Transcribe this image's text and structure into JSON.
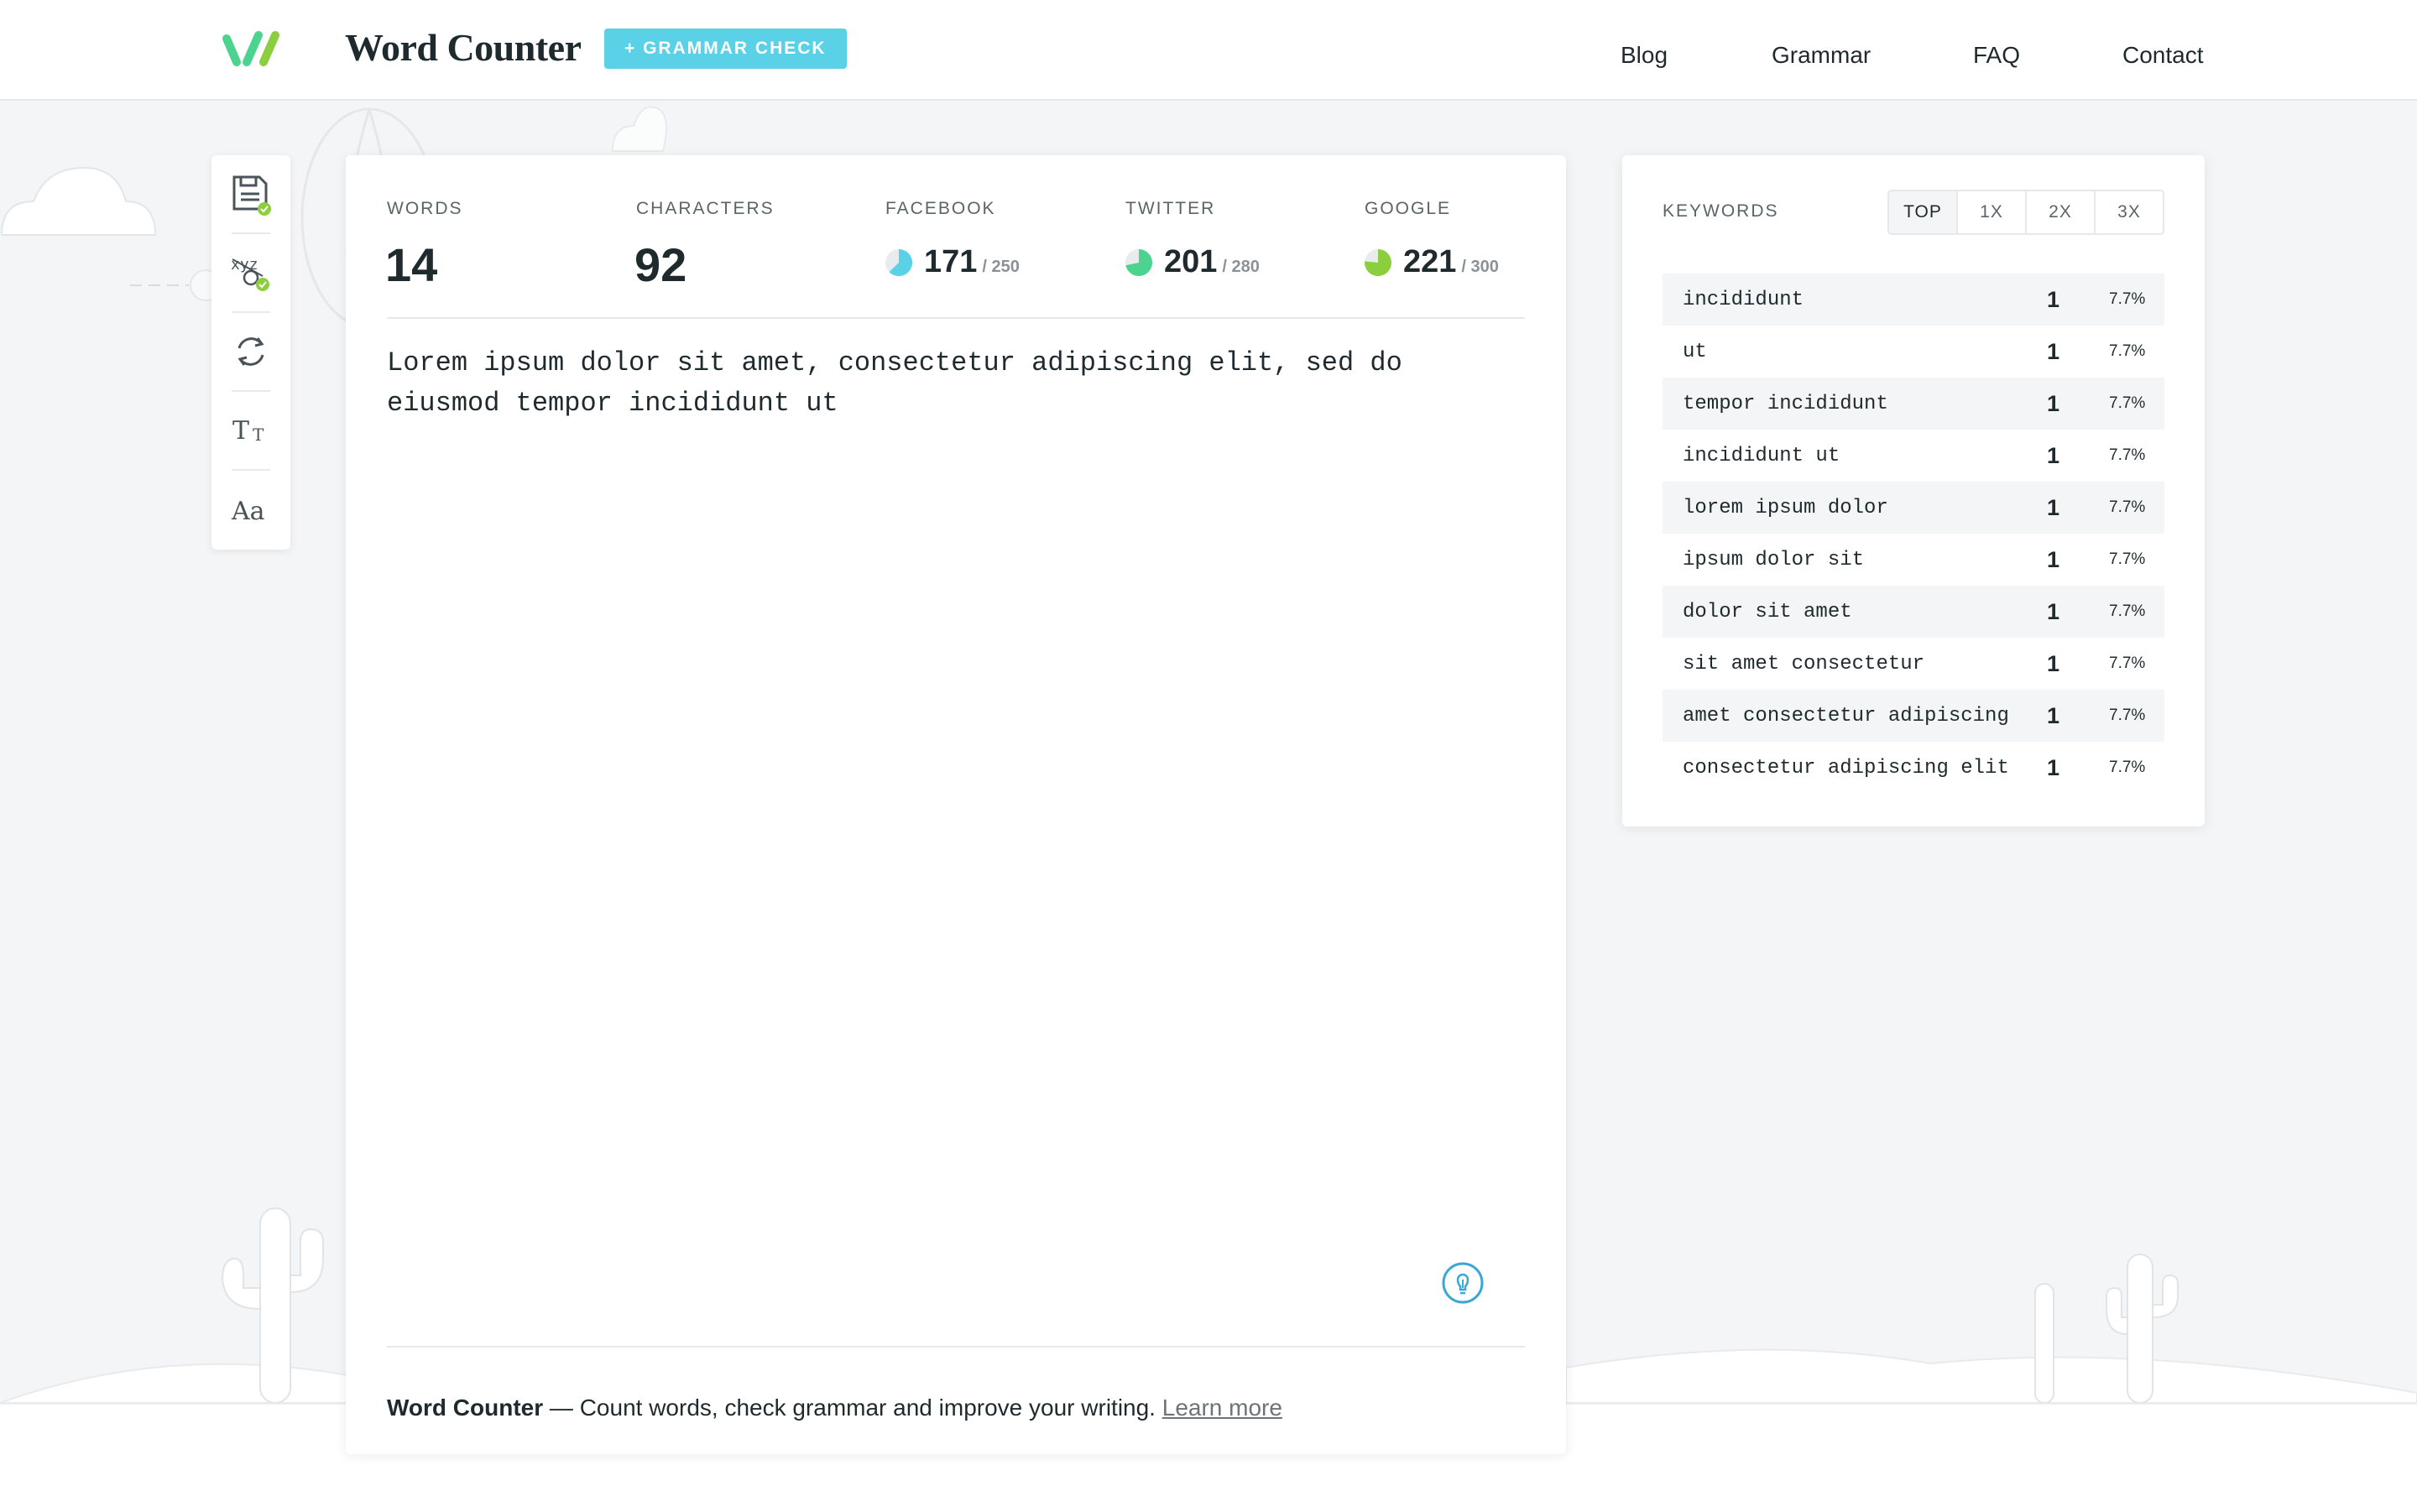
{
  "header": {
    "brand": "Word Counter",
    "grammar_button": "+ GRAMMAR CHECK",
    "nav": [
      "Blog",
      "Grammar",
      "FAQ",
      "Contact"
    ]
  },
  "toolbar": {
    "items": [
      "save-icon",
      "spellcheck-icon",
      "refresh-icon",
      "text-size-icon",
      "font-icon"
    ]
  },
  "stats": {
    "words_label": "WORDS",
    "words_value": "14",
    "characters_label": "CHARACTERS",
    "characters_value": "92",
    "facebook_label": "FACEBOOK",
    "facebook_value": "171",
    "facebook_max": "/ 250",
    "twitter_label": "TWITTER",
    "twitter_value": "201",
    "twitter_max": "/ 280",
    "google_label": "GOOGLE",
    "google_value": "221",
    "google_max": "/ 300"
  },
  "editor": {
    "text": "Lorem ipsum dolor sit amet, consectetur adipiscing elit, sed do eiusmod tempor incididunt ut"
  },
  "footer": {
    "brand": "Word Counter",
    "text": " — Count words, check grammar and improve your writing. ",
    "link": "Learn more"
  },
  "keywords": {
    "title": "KEYWORDS",
    "tabs": [
      "TOP",
      "1X",
      "2X",
      "3X"
    ],
    "active_tab": "TOP",
    "rows": [
      {
        "word": "incididunt",
        "count": "1",
        "pct": "7.7%"
      },
      {
        "word": "ut",
        "count": "1",
        "pct": "7.7%"
      },
      {
        "word": "tempor incididunt",
        "count": "1",
        "pct": "7.7%"
      },
      {
        "word": "incididunt ut",
        "count": "1",
        "pct": "7.7%"
      },
      {
        "word": "lorem ipsum dolor",
        "count": "1",
        "pct": "7.7%"
      },
      {
        "word": "ipsum dolor sit",
        "count": "1",
        "pct": "7.7%"
      },
      {
        "word": "dolor sit amet",
        "count": "1",
        "pct": "7.7%"
      },
      {
        "word": "sit amet consectetur",
        "count": "1",
        "pct": "7.7%"
      },
      {
        "word": "amet consectetur adipiscing",
        "count": "1",
        "pct": "7.7%"
      },
      {
        "word": "consectetur adipiscing elit",
        "count": "1",
        "pct": "7.7%"
      }
    ]
  },
  "colors": {
    "accent": "#5ad1e6",
    "facebook": "#5ad1e6",
    "twitter": "#4cd38f",
    "google": "#8bcf3f"
  }
}
